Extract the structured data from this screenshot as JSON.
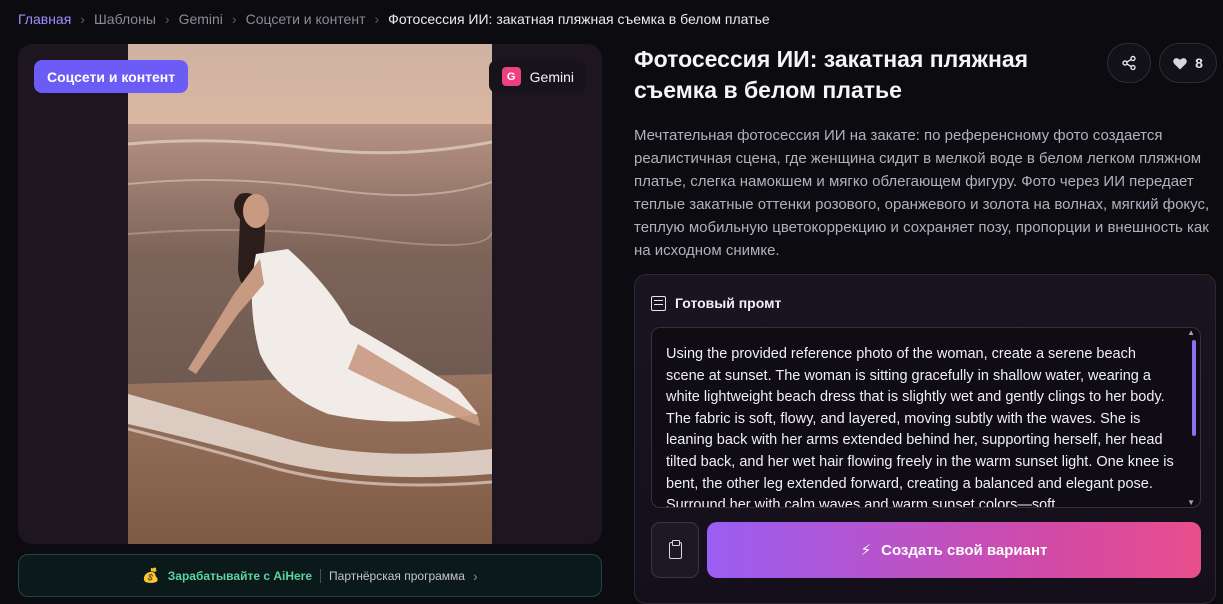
{
  "breadcrumb": {
    "items": [
      "Главная",
      "Шаблоны",
      "Gemini",
      "Соцсети и контент"
    ],
    "current": "Фотосессия ИИ: закатная пляжная съемка в белом платье",
    "separator": "›"
  },
  "preview": {
    "category_badge": "Соцсети и контент",
    "model_icon_letter": "G",
    "model_name": "Gemini"
  },
  "earn_bar": {
    "icon": "money-bag-icon",
    "earn_text": "Зарабатывайте с AiHere",
    "partner_text": "Партнёрская программа",
    "chevron": "›"
  },
  "template": {
    "title": "Фотосессия ИИ: закатная пляжная съемка в белом платье",
    "likes": "8",
    "description": "Мечтательная фотосессия ИИ на закате: по референсному фото создается реалистичная сцена, где женщина сидит в мелкой воде в белом легком пляжном платье, слегка намокшем и мягко облегающем фигуру. Фото через ИИ передает теплые закатные оттенки розового, оранжевого и золота на волнах, мягкий фокус, теплую мобильную цветокоррекцию и сохраняет позу, пропорции и внешность как на исходном снимке."
  },
  "prompt": {
    "heading": "Готовый промт",
    "text": "Using the provided reference photo of the woman, create a serene beach scene at sunset. The woman is sitting gracefully in shallow water, wearing a white lightweight beach dress that is slightly wet and gently clings to her body. The fabric is soft, flowy, and layered, moving subtly with the waves. She is leaning back with her arms extended behind her, supporting herself, her head tilted back, and her wet hair flowing freely in the warm sunset light. One knee is bent, the other leg extended forward, creating a balanced and elegant pose. Surround her with calm waves and warm sunset colors—soft",
    "create_button": "Создать свой вариант"
  },
  "colors": {
    "accent_purple": "#6a5cf5",
    "gradient_start": "#9a5ef3",
    "gradient_end": "#e94e8c",
    "earn_green": "#5cd3a2"
  }
}
